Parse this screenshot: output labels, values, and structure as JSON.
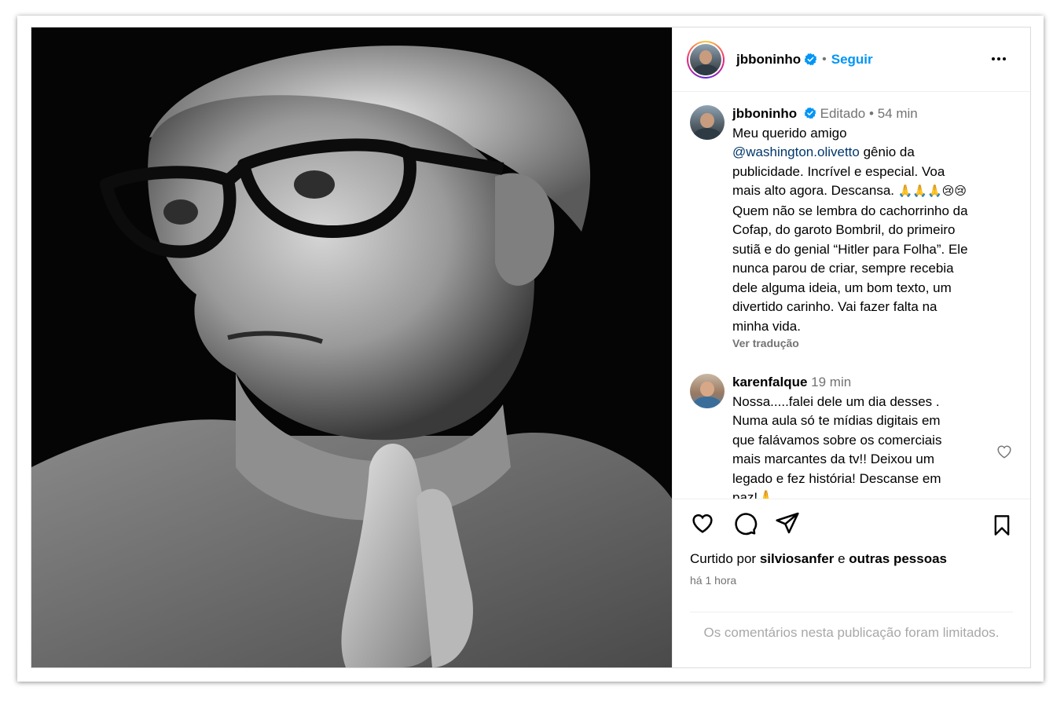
{
  "post": {
    "author": "jbboninho",
    "follow_label": "Seguir",
    "separator": "•",
    "caption": {
      "username": "jbboninho",
      "edited": "Editado",
      "time": "54 min",
      "line1": "Meu querido amigo",
      "mention": "@washington.olivetto",
      "line2_after_mention": " gênio da",
      "lines": [
        "publicidade. Incrível e especial. Voa",
        "mais alto agora. Descansa.",
        "Quem não se lembra do cachorrinho da",
        "Cofap, do garoto Bombril, do primeiro",
        "sutiã e do genial “Hitler para Folha”. Ele",
        "nunca parou de criar, sempre recebia",
        "dele alguma ideia, um bom texto, um",
        "divertido carinho. Vai fazer falta na",
        "minha vida."
      ],
      "emojis": "🙏🙏🙏😢😢",
      "see_translation": "Ver tradução"
    },
    "comments": [
      {
        "username": "karenfalque",
        "time": "19 min",
        "lines": [
          "Nossa.....falei dele um dia desses .",
          "Numa aula só te mídias digitais em",
          "que falávamos sobre os comerciais",
          "mais marcantes da tv!! Deixou um",
          "legado e fez história! Descanse em",
          "paz!🙏"
        ]
      }
    ],
    "likes": {
      "prefix": "Curtido por",
      "user": "silviosanfer",
      "conj": "e",
      "others": "outras pessoas"
    },
    "posted": "há 1 hora",
    "limited_notice": "Os comentários nesta publicação foram limitados."
  },
  "icons": {
    "like": "heart-icon",
    "comment": "comment-icon",
    "share": "share-icon",
    "save": "bookmark-icon",
    "more": "more-options-icon",
    "verified": "verified-badge-icon"
  },
  "colors": {
    "link": "#0095f6",
    "mention": "#00376b",
    "muted": "#737373",
    "verified": "#0095f6"
  }
}
